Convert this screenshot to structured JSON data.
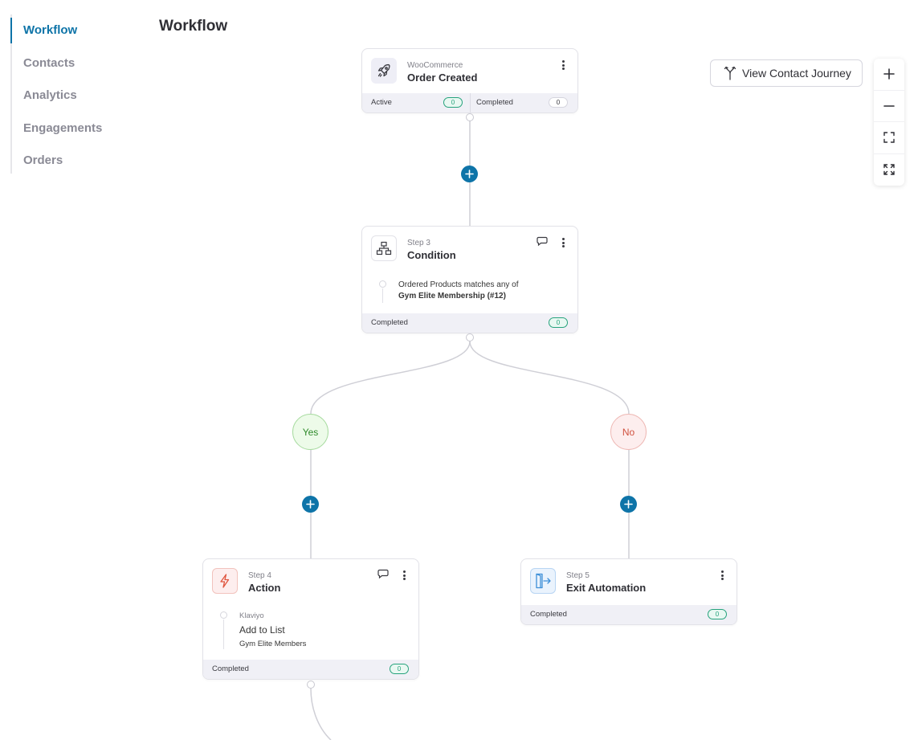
{
  "sidebar": {
    "items": [
      {
        "label": "Workflow",
        "active": true
      },
      {
        "label": "Contacts",
        "active": false
      },
      {
        "label": "Analytics",
        "active": false
      },
      {
        "label": "Engagements",
        "active": false
      },
      {
        "label": "Orders",
        "active": false
      }
    ]
  },
  "page": {
    "title": "Workflow"
  },
  "toolbar": {
    "journey_label": "View Contact Journey",
    "journey_icon": "branch-merge-icon",
    "zoom_controls": [
      "zoom-in-icon",
      "zoom-out-icon",
      "fit-view-icon",
      "fullscreen-icon"
    ]
  },
  "colors": {
    "accent": "#0e74a8",
    "success": "#26a37c",
    "yes": "#2f8a2a",
    "no": "#d0513f",
    "action_icon": "#e0553f",
    "exit_icon": "#3d8fd8"
  },
  "nodes": {
    "trigger": {
      "subtitle": "WooCommerce",
      "title": "Order Created",
      "icon": "rocket-icon",
      "active_label": "Active",
      "active_count": "0",
      "completed_label": "Completed",
      "completed_count": "0"
    },
    "condition": {
      "subtitle": "Step 3",
      "title": "Condition",
      "icon": "hierarchy-icon",
      "rule_text": "Ordered Products matches any of",
      "rule_value": "Gym Elite Membership (#12)",
      "completed_label": "Completed",
      "completed_count": "0"
    },
    "branches": {
      "yes": "Yes",
      "no": "No"
    },
    "action": {
      "subtitle": "Step 4",
      "title": "Action",
      "icon": "lightning-icon",
      "provider": "Klaviyo",
      "action_name": "Add to List",
      "action_value": "Gym Elite Members",
      "completed_label": "Completed",
      "completed_count": "0"
    },
    "exit": {
      "subtitle": "Step 5",
      "title": "Exit Automation",
      "icon": "exit-icon",
      "completed_label": "Completed",
      "completed_count": "0"
    }
  }
}
